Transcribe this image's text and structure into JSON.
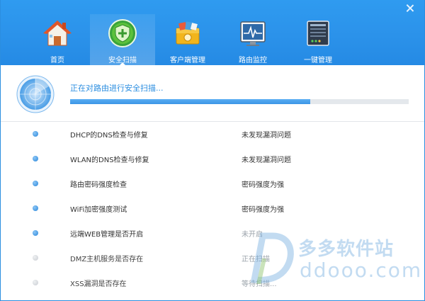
{
  "window": {
    "close_icon": "close-icon"
  },
  "nav": {
    "items": [
      {
        "label": "首页",
        "icon": "home-icon",
        "active": false
      },
      {
        "label": "安全扫描",
        "icon": "shield-plus-icon",
        "active": true
      },
      {
        "label": "客户端管理",
        "icon": "toolbox-icon",
        "active": false
      },
      {
        "label": "路由监控",
        "icon": "monitor-pulse-icon",
        "active": false
      },
      {
        "label": "一键管理",
        "icon": "router-panel-icon",
        "active": false
      }
    ]
  },
  "scan": {
    "status_text": "正在对路由进行安全扫描...",
    "progress_percent": 71,
    "radar_icon": "radar-icon",
    "accent_color": "#2b8ee0"
  },
  "items": [
    {
      "name": "DHCP的DNS检查与修复",
      "result": "未发现漏洞问题",
      "state": "done"
    },
    {
      "name": "WLAN的DNS检查与修复",
      "result": "未发现漏洞问题",
      "state": "done"
    },
    {
      "name": "路由密码强度检查",
      "result": "密码强度为强",
      "state": "done"
    },
    {
      "name": "WiFi加密强度测试",
      "result": "密码强度为强",
      "state": "done"
    },
    {
      "name": "远端WEB管理是否开启",
      "result": "未开启",
      "state": "done"
    },
    {
      "name": "DMZ主机服务是否存在",
      "result": "正在扫描",
      "state": "pending"
    },
    {
      "name": "XSS漏洞是否存在",
      "result": "等待扫描...",
      "state": "pending"
    }
  ],
  "watermark": {
    "text_cn": "多多软件站",
    "text_en": "ddooo.com"
  }
}
